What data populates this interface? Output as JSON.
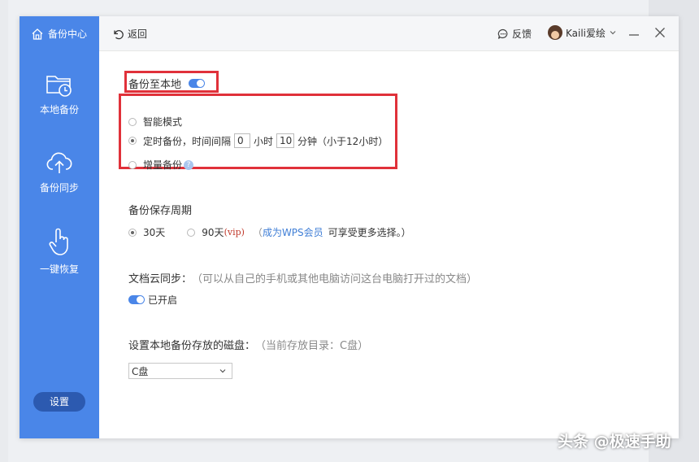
{
  "sidebar": {
    "brand": "备份中心",
    "items": [
      {
        "label": "本地备份"
      },
      {
        "label": "备份同步"
      },
      {
        "label": "一键恢复"
      }
    ],
    "settings_label": "设置"
  },
  "topbar": {
    "back_label": "返回",
    "feedback_label": "反馈",
    "username": "Kaili爱绘"
  },
  "local_backup": {
    "title": "备份至本地",
    "enabled": true,
    "modes": [
      {
        "label": "智能模式",
        "checked": false
      },
      {
        "label": "定时备份，时间间隔",
        "checked": true
      },
      {
        "label": "增量备份",
        "checked": false
      }
    ],
    "interval_hours": "0",
    "hours_unit": "小时",
    "interval_minutes": "10",
    "minutes_unit": "分钟",
    "interval_note": "（小于12小时）"
  },
  "retention": {
    "title": "备份保存周期",
    "option_30": "30天",
    "option_90": "90天",
    "vip_tag": "(vip)",
    "paren_open": "（",
    "member_link": "成为WPS会员",
    "member_suffix": "可享受更多选择。）"
  },
  "cloud_sync": {
    "title": "文档云同步：",
    "description": "（可以从自己的手机或其他电脑访问这台电脑打开过的文档）",
    "status": "已开启"
  },
  "disk": {
    "title": "设置本地备份存放的磁盘：",
    "current": "（当前存放目录：C盘）",
    "selected": "C盘"
  },
  "watermark": "头条 @极速手助",
  "colors": {
    "accent": "#4a86e8",
    "highlight": "#e0313a",
    "link": "#3f7ed6"
  }
}
